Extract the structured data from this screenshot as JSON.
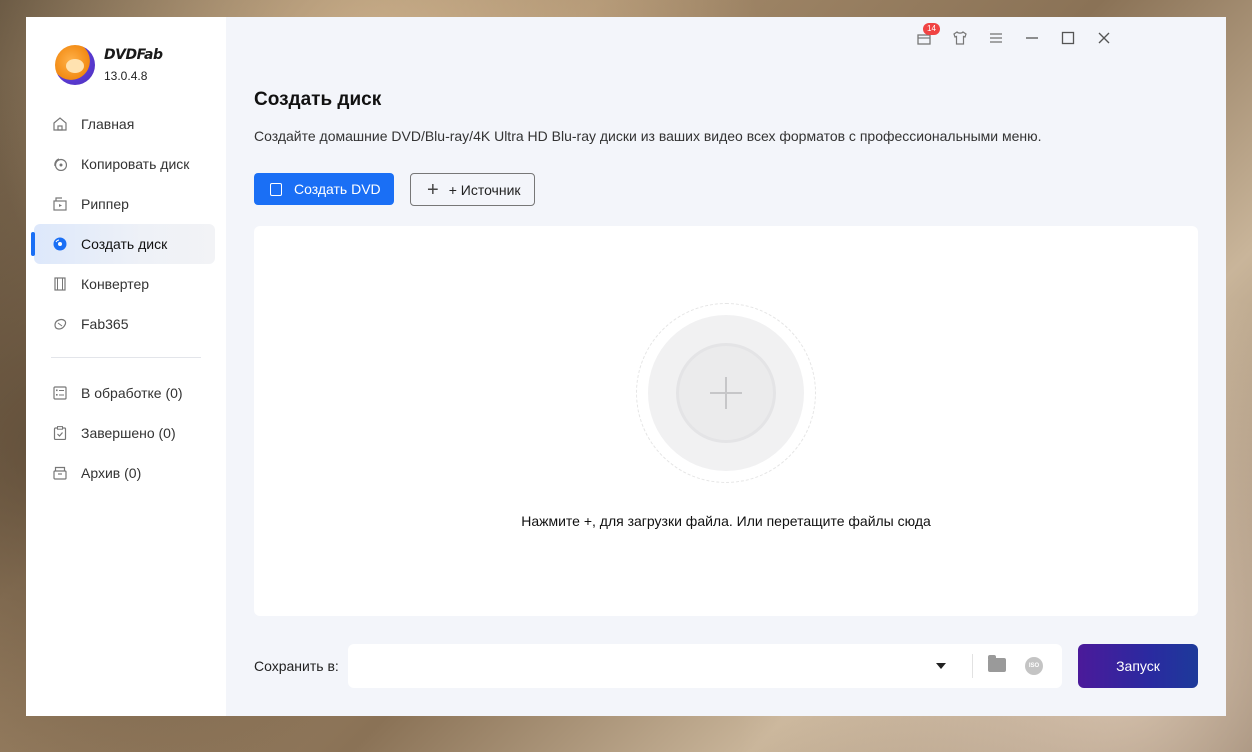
{
  "app": {
    "brand": "DVDFab",
    "version": "13.0.4.8"
  },
  "sidebar": {
    "items": [
      {
        "label": "Главная",
        "icon": "home-icon"
      },
      {
        "label": "Копировать диск",
        "icon": "copy-disc-icon"
      },
      {
        "label": "Риппер",
        "icon": "ripper-icon"
      },
      {
        "label": "Создать диск",
        "icon": "create-disc-icon",
        "active": true
      },
      {
        "label": "Конвертер",
        "icon": "film-icon"
      },
      {
        "label": "Fab365",
        "icon": "fab365-icon"
      }
    ],
    "tasks": [
      {
        "label": "В обработке (0)",
        "icon": "list-icon"
      },
      {
        "label": "Завершено (0)",
        "icon": "clipboard-check-icon"
      },
      {
        "label": "Архив (0)",
        "icon": "archive-icon"
      }
    ]
  },
  "topbar": {
    "notification_count": "14"
  },
  "main": {
    "title": "Создать диск",
    "description": "Создайте домашние DVD/Blu-ray/4K Ultra HD Blu-ray диски из ваших видео всех форматов с профессиональными меню.",
    "create_button_label": "Создать DVD",
    "source_button_label": "+ Источник",
    "drop_hint": "Нажмите +, для загрузки файла. Или перетащите файлы сюда",
    "save_label": "Сохранить в:",
    "save_value": "",
    "iso_label": "ISO",
    "start_label": "Запуск"
  },
  "colors": {
    "accent": "#1a6ff5",
    "start_gradient_start": "#4b1a9a",
    "start_gradient_end": "#1d3a9a"
  }
}
